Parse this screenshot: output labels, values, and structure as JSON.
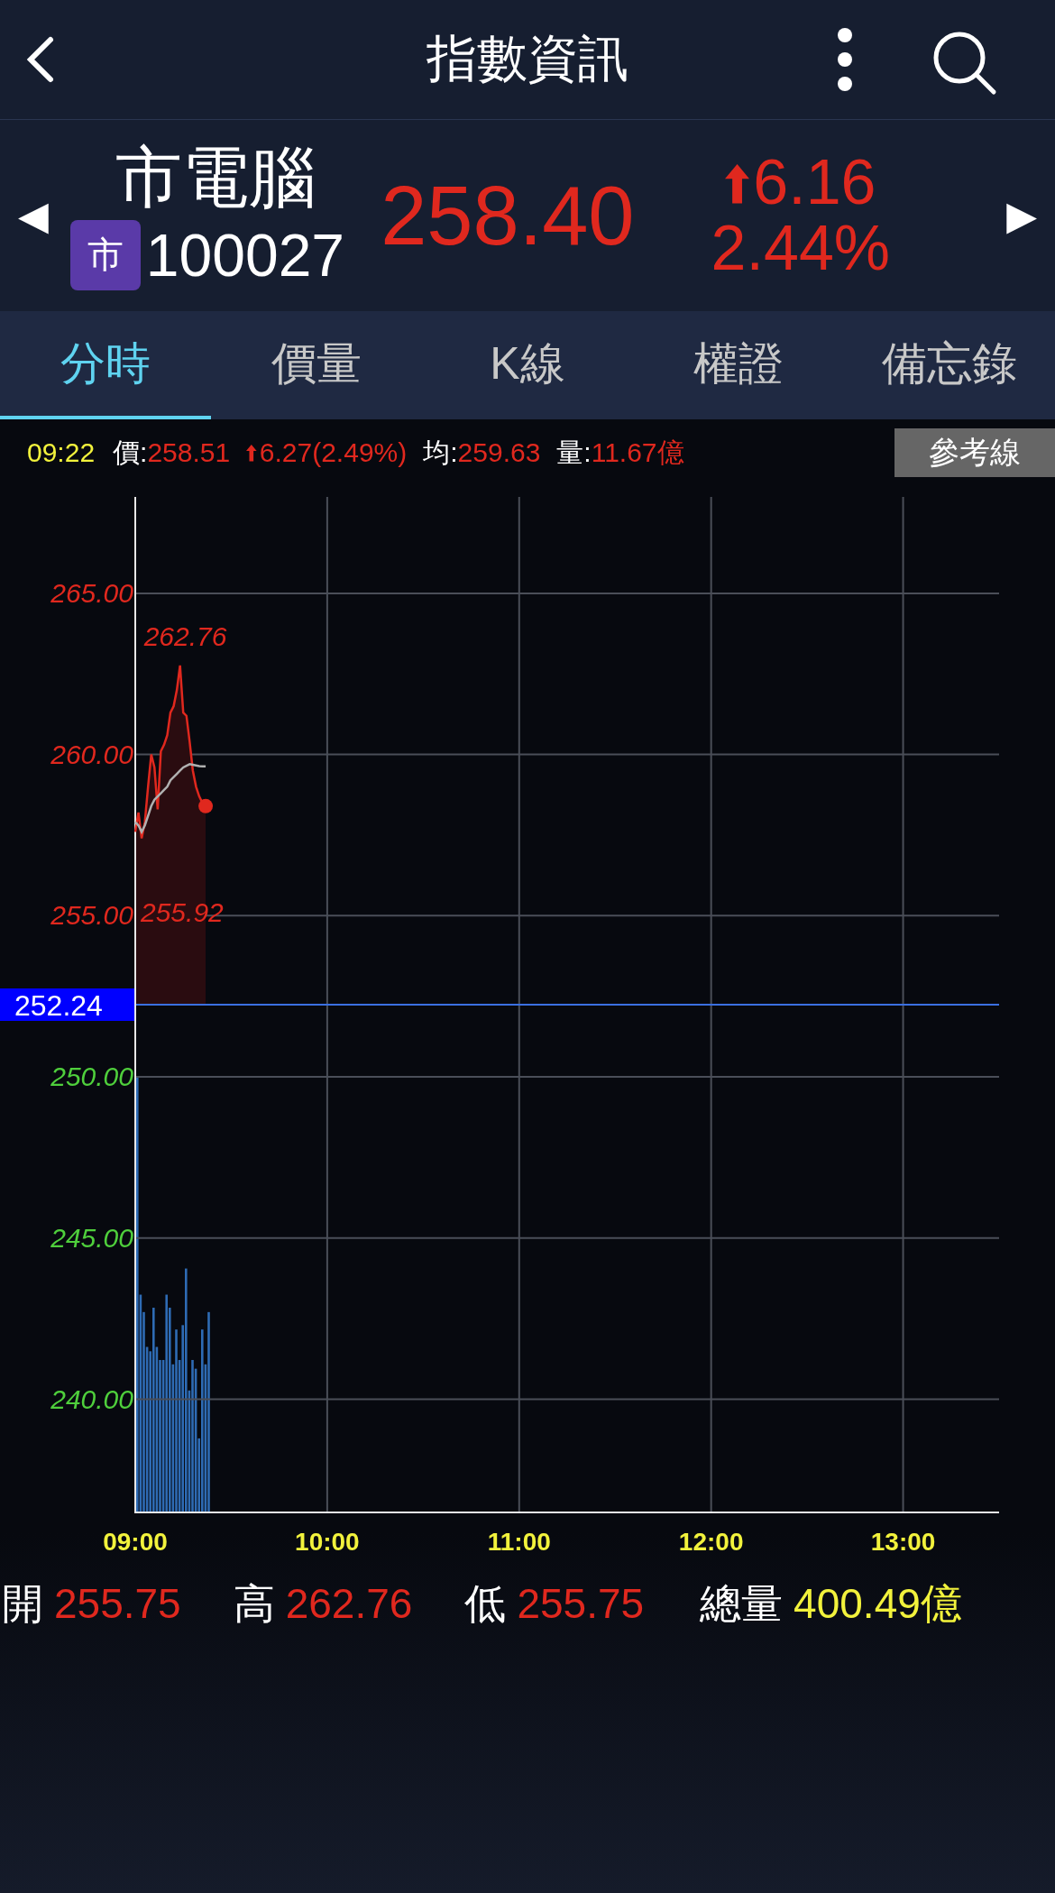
{
  "header": {
    "title": "指數資訊"
  },
  "quote": {
    "prev": "◀",
    "name": "市電腦",
    "badge": "市",
    "code": "100027",
    "price": "258.40",
    "change": "6.16",
    "change_percent": "2.44%",
    "next": "▶"
  },
  "tabs": [
    {
      "label": "分時",
      "selected": true
    },
    {
      "label": "價量",
      "selected": false
    },
    {
      "label": "K線",
      "selected": false
    },
    {
      "label": "權證",
      "selected": false
    },
    {
      "label": "備忘錄",
      "selected": false
    }
  ],
  "info_line": {
    "time": "09:22",
    "price_label": "價:",
    "price": "258.51",
    "change": "6.27(2.49%)",
    "avg_label": "均:",
    "avg": "259.63",
    "volume_label": "量:",
    "volume": "11.67億",
    "button": "參考線"
  },
  "chart": {
    "chart_data": {
      "type": "line",
      "grid": true,
      "ref_lines": [
        {
          "axis": "y",
          "value": 252.24,
          "label": "252.24"
        }
      ],
      "x": [
        9,
        9.0167,
        9.0333,
        9.05,
        9.0667,
        9.0833,
        9.1,
        9.1167,
        9.1333,
        9.15,
        9.1667,
        9.1833,
        9.2,
        9.2167,
        9.2333,
        9.25,
        9.2667,
        9.2833,
        9.3,
        9.3167,
        9.3333,
        9.35,
        9.3667
      ],
      "series": [
        {
          "color": "#e0281e",
          "values": [
            257.6,
            258.2,
            257.4,
            257.9,
            259.0,
            260.0,
            259.6,
            258.3,
            260.1,
            260.3,
            260.6,
            261.3,
            261.5,
            262.0,
            262.76,
            261.3,
            261.2,
            260.4,
            259.5,
            259.0,
            258.7,
            258.5,
            258.4
          ]
        },
        {
          "color": "#b0b0b0",
          "values": [
            257.9,
            257.8,
            257.6,
            257.8,
            258.1,
            258.4,
            258.6,
            258.7,
            258.8,
            258.9,
            259.0,
            259.2,
            259.3,
            259.4,
            259.5,
            259.6,
            259.65,
            259.7,
            259.68,
            259.66,
            259.64,
            259.63,
            259.63
          ]
        }
      ],
      "xlim": [
        9,
        13.5
      ],
      "ylim": [
        236.49,
        267.99
      ],
      "xticks": [
        {
          "value": 9,
          "label": "09:00"
        },
        {
          "value": 10,
          "label": "10:00"
        },
        {
          "value": 11,
          "label": "11:00"
        },
        {
          "value": 12,
          "label": "12:00"
        },
        {
          "value": 13,
          "label": "13:00"
        }
      ],
      "yticks": [
        {
          "value": 240,
          "label": "240.00"
        },
        {
          "value": 245,
          "label": "245.00"
        },
        {
          "value": 250,
          "label": "250.00"
        },
        {
          "value": 255,
          "label": "255.00"
        },
        {
          "value": 260,
          "label": "260.00"
        },
        {
          "value": 265,
          "label": "265.00"
        }
      ],
      "annotations": [
        {
          "x": 9.2333,
          "y": 262.76,
          "text": "262.76"
        },
        {
          "text": "255.92"
        }
      ]
    }
  },
  "summary": [
    {
      "label": "開",
      "value": "255.75",
      "color": "#e0281e"
    },
    {
      "label": "高",
      "value": "262.76",
      "color": "#e0281e"
    },
    {
      "label": "低",
      "value": "255.75",
      "color": "#e0281e"
    },
    {
      "label": "總量",
      "value": "400.49億",
      "color": "#f2f23c"
    }
  ]
}
